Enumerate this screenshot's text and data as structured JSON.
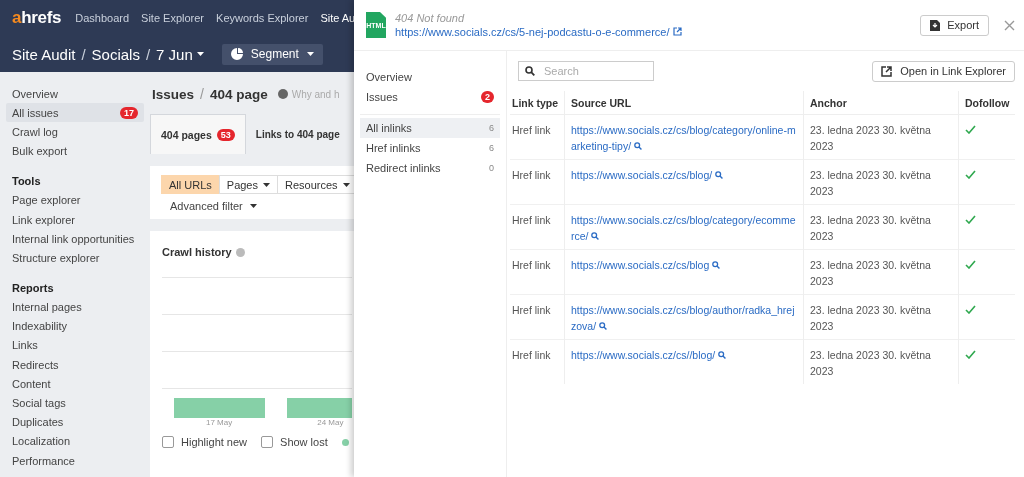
{
  "top_nav": {
    "logo": "ahrefs",
    "items": [
      {
        "label": "Dashboard",
        "selected": false
      },
      {
        "label": "Site Explorer",
        "selected": false
      },
      {
        "label": "Keywords Explorer",
        "selected": false
      },
      {
        "label": "Site Au",
        "selected": true
      }
    ]
  },
  "breadcrumb": [
    {
      "label": "Site Audit"
    },
    {
      "separator": "/",
      "label": "Socials"
    },
    {
      "separator": "/",
      "label": "7 Jun",
      "dropdown": true
    }
  ],
  "segment_button": "Segment",
  "sidebar": {
    "items": [
      {
        "label": "Overview",
        "selected": false
      },
      {
        "label": "All issues",
        "selected": true,
        "badge": "17"
      },
      {
        "label": "Crawl log",
        "selected": false
      },
      {
        "label": "Bulk export",
        "selected": false
      }
    ],
    "sections": [
      {
        "title": "Tools",
        "items": [
          {
            "label": "Page explorer",
            "selected": false
          },
          {
            "label": "Link explorer",
            "selected": false
          },
          {
            "label": "Internal link opportunities",
            "selected": false
          },
          {
            "label": "Structure explorer",
            "selected": false
          }
        ]
      },
      {
        "title": "Reports",
        "items": [
          {
            "label": "Internal pages",
            "selected": false
          },
          {
            "label": "Indexability",
            "selected": false
          },
          {
            "label": "Links",
            "selected": false
          },
          {
            "label": "Redirects",
            "selected": false
          },
          {
            "label": "Content",
            "selected": false
          },
          {
            "label": "Social tags",
            "selected": false
          },
          {
            "label": "Duplicates",
            "selected": false
          },
          {
            "label": "Localization",
            "selected": false
          },
          {
            "label": "Performance",
            "selected": false
          }
        ]
      }
    ]
  },
  "main": {
    "title": "Issues",
    "title_separator": "/",
    "subtitle": "404 page",
    "help": "Why and h",
    "tabs": [
      {
        "label": "404 pages",
        "badge": "53",
        "selected": true
      },
      {
        "label": "Links to 404 page",
        "selected": false
      }
    ],
    "filters": [
      {
        "label": "All URLs",
        "selected": true,
        "dropdown": false
      },
      {
        "label": "Pages",
        "selected": false,
        "dropdown": true
      },
      {
        "label": "Resources",
        "selected": false,
        "dropdown": true
      }
    ],
    "advanced_filter": "Advanced filter",
    "crawl_history": {
      "title": "Crawl history",
      "x_labels": [
        "17 May",
        "24 May"
      ],
      "checkboxes": [
        {
          "label": "Highlight new",
          "checked": false
        },
        {
          "label": "Show lost",
          "checked": false
        }
      ]
    }
  },
  "panel": {
    "file_icon_label": "HTML",
    "status": "404 Not found",
    "url": "https://www.socials.cz/cs/5-nej-podcastu-o-e-commerce/",
    "export": "Export",
    "nav": [
      {
        "label": "Overview",
        "selected": false
      },
      {
        "label": "Issues",
        "selected": false,
        "badge": "2"
      }
    ],
    "inlinks": [
      {
        "label": "All inlinks",
        "count": "6",
        "selected": true
      },
      {
        "label": "Href inlinks",
        "count": "6",
        "selected": false
      },
      {
        "label": "Redirect inlinks",
        "count": "0",
        "selected": false
      }
    ],
    "search": {
      "placeholder": "Search"
    },
    "open_button": "Open in Link Explorer",
    "columns": [
      "Link type",
      "Source URL",
      "Anchor",
      "Dofollow"
    ],
    "rows": [
      {
        "link_type": "Href link",
        "source_url": "https://www.socials.cz/cs/blog/category/online-marketing-tipy/",
        "anchor": "23. ledna 2023 30. května 2023",
        "dofollow": true
      },
      {
        "link_type": "Href link",
        "source_url": "https://www.socials.cz/cs/blog/",
        "anchor": "23. ledna 2023 30. května 2023",
        "dofollow": true
      },
      {
        "link_type": "Href link",
        "source_url": "https://www.socials.cz/cs/blog/category/ecommerce/",
        "anchor": "23. ledna 2023 30. května 2023",
        "dofollow": true
      },
      {
        "link_type": "Href link",
        "source_url": "https://www.socials.cz/cs/blog",
        "anchor": "23. ledna 2023 30. května 2023",
        "dofollow": true
      },
      {
        "link_type": "Href link",
        "source_url": "https://www.socials.cz/cs/blog/author/radka_hrejzova/",
        "anchor": "23. ledna 2023 30. května 2023",
        "dofollow": true
      },
      {
        "link_type": "Href link",
        "source_url": "https://www.socials.cz/cs//blog/",
        "anchor": "23. ledna 2023 30. května 2023",
        "dofollow": true
      }
    ]
  }
}
